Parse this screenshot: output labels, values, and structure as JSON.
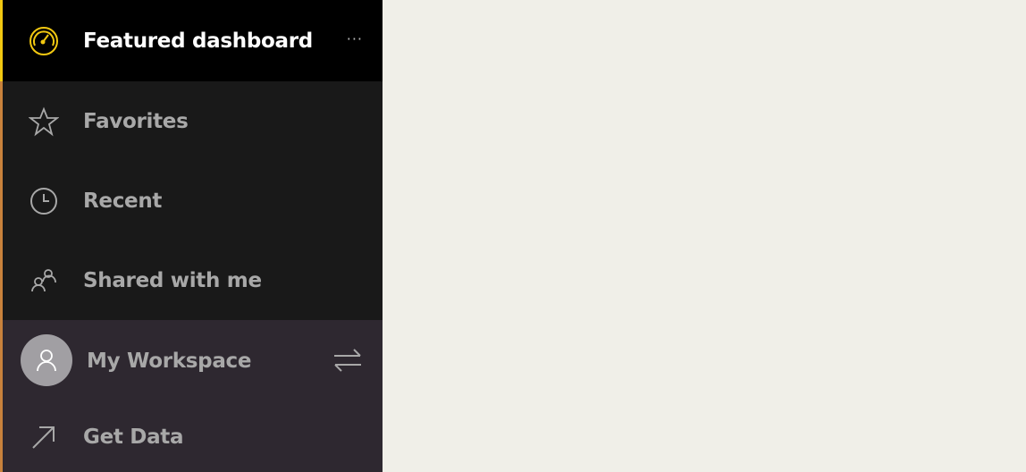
{
  "sidebar": {
    "featured": {
      "label": "Featured dashboard",
      "icon": "gauge-icon",
      "more": "···"
    },
    "items": [
      {
        "label": "Favorites",
        "icon": "star-icon"
      },
      {
        "label": "Recent",
        "icon": "clock-icon"
      },
      {
        "label": "Shared with me",
        "icon": "people-icon"
      }
    ],
    "workspace": {
      "label": "My Workspace",
      "icon": "avatar-icon",
      "switch_icon": "swap-icon"
    },
    "get_data": {
      "label": "Get Data",
      "icon": "arrow-up-right-icon"
    }
  },
  "colors": {
    "accent": "#f2c811",
    "sidebar_bg": "#191919",
    "workspace_bg": "#2e2830",
    "main_bg": "#f0efe8"
  }
}
